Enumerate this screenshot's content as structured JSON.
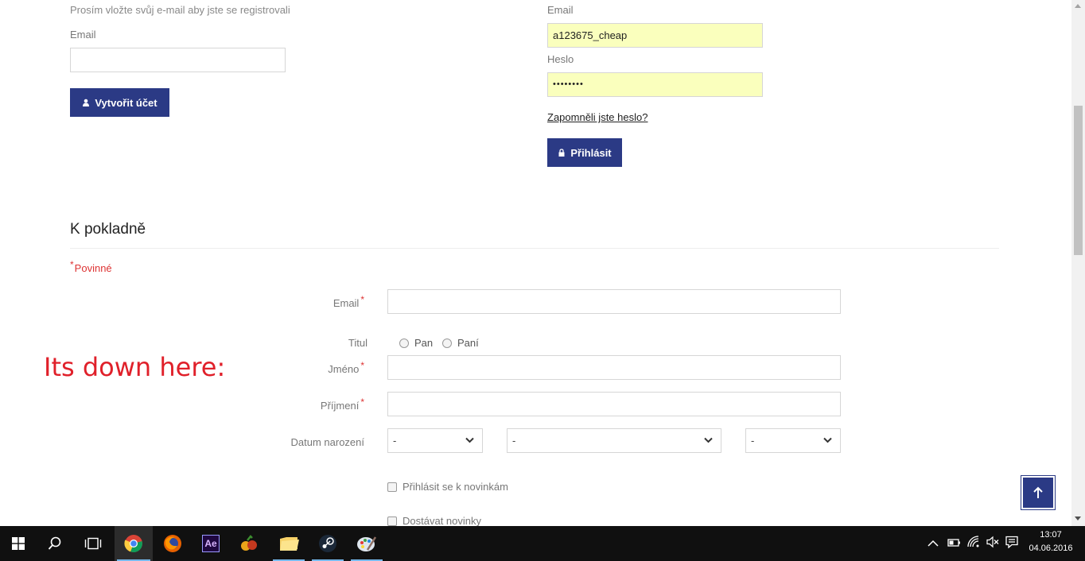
{
  "register": {
    "intro": "Prosím vložte svůj e-mail aby jste se registrovali",
    "email_label": "Email",
    "email_value": "",
    "button_label": "Vytvořit účet"
  },
  "login": {
    "email_label": "Email",
    "email_value": "a123675_cheap",
    "password_label": "Heslo",
    "password_value": "••••••••",
    "forgot_link": "Zapomněli jste heslo?",
    "button_label": "Přihlásit"
  },
  "checkout": {
    "title": "K pokladně",
    "required_note": "Povinné",
    "required_mark": "*",
    "email_label": "Email",
    "title_label": "Titul",
    "title_options": [
      "Pan",
      "Paní"
    ],
    "first_name_label": "Jméno",
    "last_name_label": "Příjmení",
    "birth_date_label": "Datum narození",
    "birth_day_value": "-",
    "birth_month_value": "-",
    "birth_year_value": "-",
    "newsletter_label": "Přihlásit se k novinkám",
    "news_label": "Dostávat novinky"
  },
  "annotation": {
    "text": "Its down here:",
    "color": "#e0202a"
  },
  "colors": {
    "accent": "#2b3a85",
    "autofill": "#faffbd",
    "required": "#d33333"
  },
  "taskbar": {
    "apps": [
      "windows-start",
      "search",
      "task-view",
      "chrome",
      "firefox",
      "after-effects",
      "fruit-app",
      "file-explorer",
      "steam",
      "paint"
    ],
    "ae_label": "Ae",
    "time": "13:07",
    "date": "04.06.2016"
  }
}
